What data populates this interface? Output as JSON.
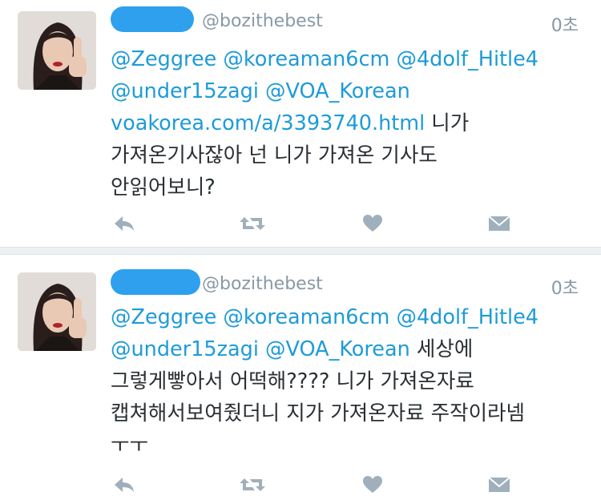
{
  "tweets": [
    {
      "handle": "@bozithebest",
      "time": "0초",
      "mentions_line1": "@Zeggree @koreaman6cm @4dolf_Hitle4",
      "mentions_line2": "@under15zagi @VOA_Korean",
      "url": "voakorea.com/a/3393740.html",
      "text_after_url": " 니가",
      "line4": "가져온기사잖아 넌 니가 가져온 기사도",
      "line5": "안읽어보니?"
    },
    {
      "handle": "@bozithebest",
      "time": "0초",
      "mentions_line1": "@Zeggree @koreaman6cm @4dolf_Hitle4",
      "mentions_line2": "@under15zagi @VOA_Korean",
      "text_after_mention": " 세상에",
      "line3": "그렇게빻아서 어떡해???? 니가 가져온자료",
      "line4": "캡쳐해서보여줬더니 지가 가져온자료 주작이라넴",
      "line5": "ㅜㅜ"
    }
  ],
  "icons": [
    "reply-icon",
    "retweet-icon",
    "like-icon",
    "message-icon"
  ],
  "colors": {
    "link": "#1d9bd8",
    "redaction": "#2ea0ee",
    "muted": "#8899a6",
    "icon": "#9fb0bc",
    "text": "#292f33"
  }
}
